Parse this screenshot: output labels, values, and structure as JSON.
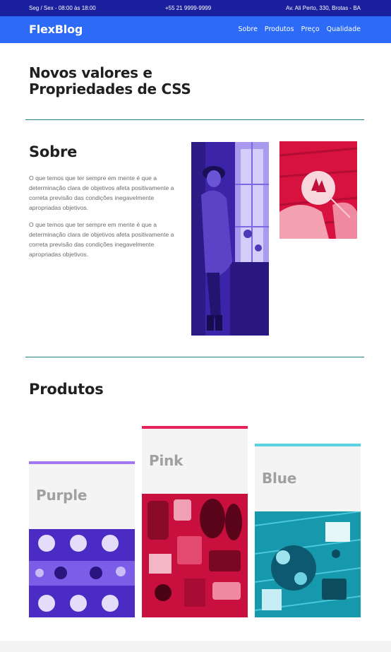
{
  "topbar": {
    "hours": "Seg / Sex - 08:00 às 18:00",
    "phone": "+55 21 9999-9999",
    "address": "Av. Ali Perto, 330, Brotas - BA"
  },
  "header": {
    "logo": "FlexBlog",
    "nav": [
      "Sobre",
      "Produtos",
      "Preço",
      "Qualidade"
    ]
  },
  "hero": {
    "title_line1": "Novos valores e",
    "title_line2": "Propriedades de CSS"
  },
  "sobre": {
    "title": "Sobre",
    "paragraph1": "O que temos que ter sempre em mente é que a determinação clara de objetivos afeta positivamente a correta previsão das condições inegavelmente apropriadas objetivos.",
    "paragraph2": "O que temos que ter sempre em mente é que a determinação clara de objetivos afeta positivamente a correta previsão das condições inegavelmente apropriadas objetivos."
  },
  "produtos": {
    "title": "Produtos",
    "cards": [
      {
        "label": "Purple",
        "accent": "#a377f0"
      },
      {
        "label": "Pink",
        "accent": "#e8215a"
      },
      {
        "label": "Blue",
        "accent": "#5ad0e0"
      }
    ]
  },
  "colors": {
    "topbar": "#1a1f9e",
    "header": "#2d6bf7",
    "divider": "#2a7c8c"
  }
}
